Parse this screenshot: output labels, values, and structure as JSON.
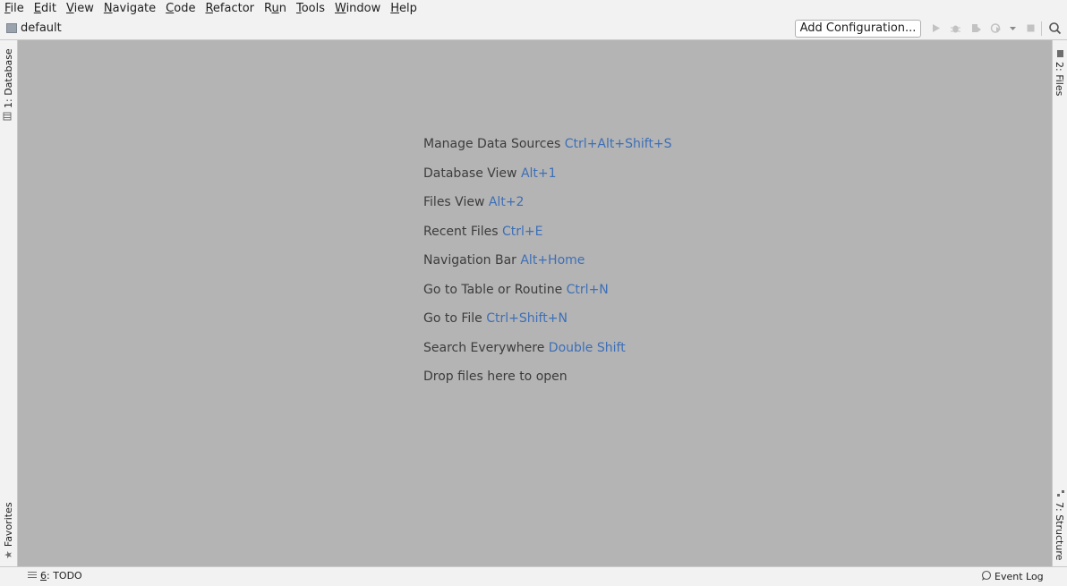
{
  "menu": [
    {
      "mnemonic": "F",
      "rest": "ile"
    },
    {
      "mnemonic": "E",
      "rest": "dit"
    },
    {
      "mnemonic": "V",
      "rest": "iew"
    },
    {
      "mnemonic": "N",
      "rest": "avigate"
    },
    {
      "mnemonic": "C",
      "rest": "ode"
    },
    {
      "mnemonic": "R",
      "rest": "efactor"
    },
    {
      "pre": "R",
      "mnemonic": "u",
      "rest": "n"
    },
    {
      "mnemonic": "T",
      "rest": "ools"
    },
    {
      "mnemonic": "W",
      "rest": "indow"
    },
    {
      "mnemonic": "H",
      "rest": "elp"
    }
  ],
  "navbar": {
    "project": "default",
    "add_configuration": "Add Configuration..."
  },
  "left_strip": {
    "database_tab": "1: Database",
    "favorites_tab": "Favorites"
  },
  "right_strip": {
    "files_tab": "2: Files",
    "structure_tab": "7: Structure"
  },
  "hints": [
    {
      "label": "Manage Data Sources",
      "shortcut": "Ctrl+Alt+Shift+S"
    },
    {
      "label": "Database View",
      "shortcut": "Alt+1"
    },
    {
      "label": "Files View",
      "shortcut": "Alt+2"
    },
    {
      "label": "Recent Files",
      "shortcut": "Ctrl+E"
    },
    {
      "label": "Navigation Bar",
      "shortcut": "Alt+Home"
    },
    {
      "label": "Go to Table or Routine",
      "shortcut": "Ctrl+N"
    },
    {
      "label": "Go to File",
      "shortcut": "Ctrl+Shift+N"
    },
    {
      "label": "Search Everywhere",
      "shortcut": "Double Shift"
    },
    {
      "label": "Drop files here to open",
      "shortcut": ""
    }
  ],
  "status": {
    "todo_num": "6",
    "todo_rest": ": TODO",
    "event_log": "Event Log"
  },
  "colors": {
    "editor_bg": "#b4b4b4",
    "shortcut": "#3d6fb7",
    "chrome_bg": "#f2f2f2"
  }
}
